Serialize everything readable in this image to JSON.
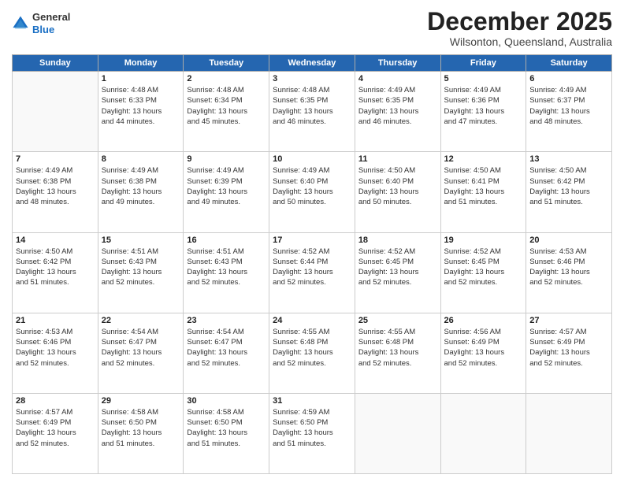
{
  "logo": {
    "general": "General",
    "blue": "Blue"
  },
  "header": {
    "month": "December 2025",
    "location": "Wilsonton, Queensland, Australia"
  },
  "days_of_week": [
    "Sunday",
    "Monday",
    "Tuesday",
    "Wednesday",
    "Thursday",
    "Friday",
    "Saturday"
  ],
  "weeks": [
    [
      {
        "day": "",
        "info": ""
      },
      {
        "day": "1",
        "info": "Sunrise: 4:48 AM\nSunset: 6:33 PM\nDaylight: 13 hours\nand 44 minutes."
      },
      {
        "day": "2",
        "info": "Sunrise: 4:48 AM\nSunset: 6:34 PM\nDaylight: 13 hours\nand 45 minutes."
      },
      {
        "day": "3",
        "info": "Sunrise: 4:48 AM\nSunset: 6:35 PM\nDaylight: 13 hours\nand 46 minutes."
      },
      {
        "day": "4",
        "info": "Sunrise: 4:49 AM\nSunset: 6:35 PM\nDaylight: 13 hours\nand 46 minutes."
      },
      {
        "day": "5",
        "info": "Sunrise: 4:49 AM\nSunset: 6:36 PM\nDaylight: 13 hours\nand 47 minutes."
      },
      {
        "day": "6",
        "info": "Sunrise: 4:49 AM\nSunset: 6:37 PM\nDaylight: 13 hours\nand 48 minutes."
      }
    ],
    [
      {
        "day": "7",
        "info": "Sunrise: 4:49 AM\nSunset: 6:38 PM\nDaylight: 13 hours\nand 48 minutes."
      },
      {
        "day": "8",
        "info": "Sunrise: 4:49 AM\nSunset: 6:38 PM\nDaylight: 13 hours\nand 49 minutes."
      },
      {
        "day": "9",
        "info": "Sunrise: 4:49 AM\nSunset: 6:39 PM\nDaylight: 13 hours\nand 49 minutes."
      },
      {
        "day": "10",
        "info": "Sunrise: 4:49 AM\nSunset: 6:40 PM\nDaylight: 13 hours\nand 50 minutes."
      },
      {
        "day": "11",
        "info": "Sunrise: 4:50 AM\nSunset: 6:40 PM\nDaylight: 13 hours\nand 50 minutes."
      },
      {
        "day": "12",
        "info": "Sunrise: 4:50 AM\nSunset: 6:41 PM\nDaylight: 13 hours\nand 51 minutes."
      },
      {
        "day": "13",
        "info": "Sunrise: 4:50 AM\nSunset: 6:42 PM\nDaylight: 13 hours\nand 51 minutes."
      }
    ],
    [
      {
        "day": "14",
        "info": "Sunrise: 4:50 AM\nSunset: 6:42 PM\nDaylight: 13 hours\nand 51 minutes."
      },
      {
        "day": "15",
        "info": "Sunrise: 4:51 AM\nSunset: 6:43 PM\nDaylight: 13 hours\nand 52 minutes."
      },
      {
        "day": "16",
        "info": "Sunrise: 4:51 AM\nSunset: 6:43 PM\nDaylight: 13 hours\nand 52 minutes."
      },
      {
        "day": "17",
        "info": "Sunrise: 4:52 AM\nSunset: 6:44 PM\nDaylight: 13 hours\nand 52 minutes."
      },
      {
        "day": "18",
        "info": "Sunrise: 4:52 AM\nSunset: 6:45 PM\nDaylight: 13 hours\nand 52 minutes."
      },
      {
        "day": "19",
        "info": "Sunrise: 4:52 AM\nSunset: 6:45 PM\nDaylight: 13 hours\nand 52 minutes."
      },
      {
        "day": "20",
        "info": "Sunrise: 4:53 AM\nSunset: 6:46 PM\nDaylight: 13 hours\nand 52 minutes."
      }
    ],
    [
      {
        "day": "21",
        "info": "Sunrise: 4:53 AM\nSunset: 6:46 PM\nDaylight: 13 hours\nand 52 minutes."
      },
      {
        "day": "22",
        "info": "Sunrise: 4:54 AM\nSunset: 6:47 PM\nDaylight: 13 hours\nand 52 minutes."
      },
      {
        "day": "23",
        "info": "Sunrise: 4:54 AM\nSunset: 6:47 PM\nDaylight: 13 hours\nand 52 minutes."
      },
      {
        "day": "24",
        "info": "Sunrise: 4:55 AM\nSunset: 6:48 PM\nDaylight: 13 hours\nand 52 minutes."
      },
      {
        "day": "25",
        "info": "Sunrise: 4:55 AM\nSunset: 6:48 PM\nDaylight: 13 hours\nand 52 minutes."
      },
      {
        "day": "26",
        "info": "Sunrise: 4:56 AM\nSunset: 6:49 PM\nDaylight: 13 hours\nand 52 minutes."
      },
      {
        "day": "27",
        "info": "Sunrise: 4:57 AM\nSunset: 6:49 PM\nDaylight: 13 hours\nand 52 minutes."
      }
    ],
    [
      {
        "day": "28",
        "info": "Sunrise: 4:57 AM\nSunset: 6:49 PM\nDaylight: 13 hours\nand 52 minutes."
      },
      {
        "day": "29",
        "info": "Sunrise: 4:58 AM\nSunset: 6:50 PM\nDaylight: 13 hours\nand 51 minutes."
      },
      {
        "day": "30",
        "info": "Sunrise: 4:58 AM\nSunset: 6:50 PM\nDaylight: 13 hours\nand 51 minutes."
      },
      {
        "day": "31",
        "info": "Sunrise: 4:59 AM\nSunset: 6:50 PM\nDaylight: 13 hours\nand 51 minutes."
      },
      {
        "day": "",
        "info": ""
      },
      {
        "day": "",
        "info": ""
      },
      {
        "day": "",
        "info": ""
      }
    ]
  ]
}
